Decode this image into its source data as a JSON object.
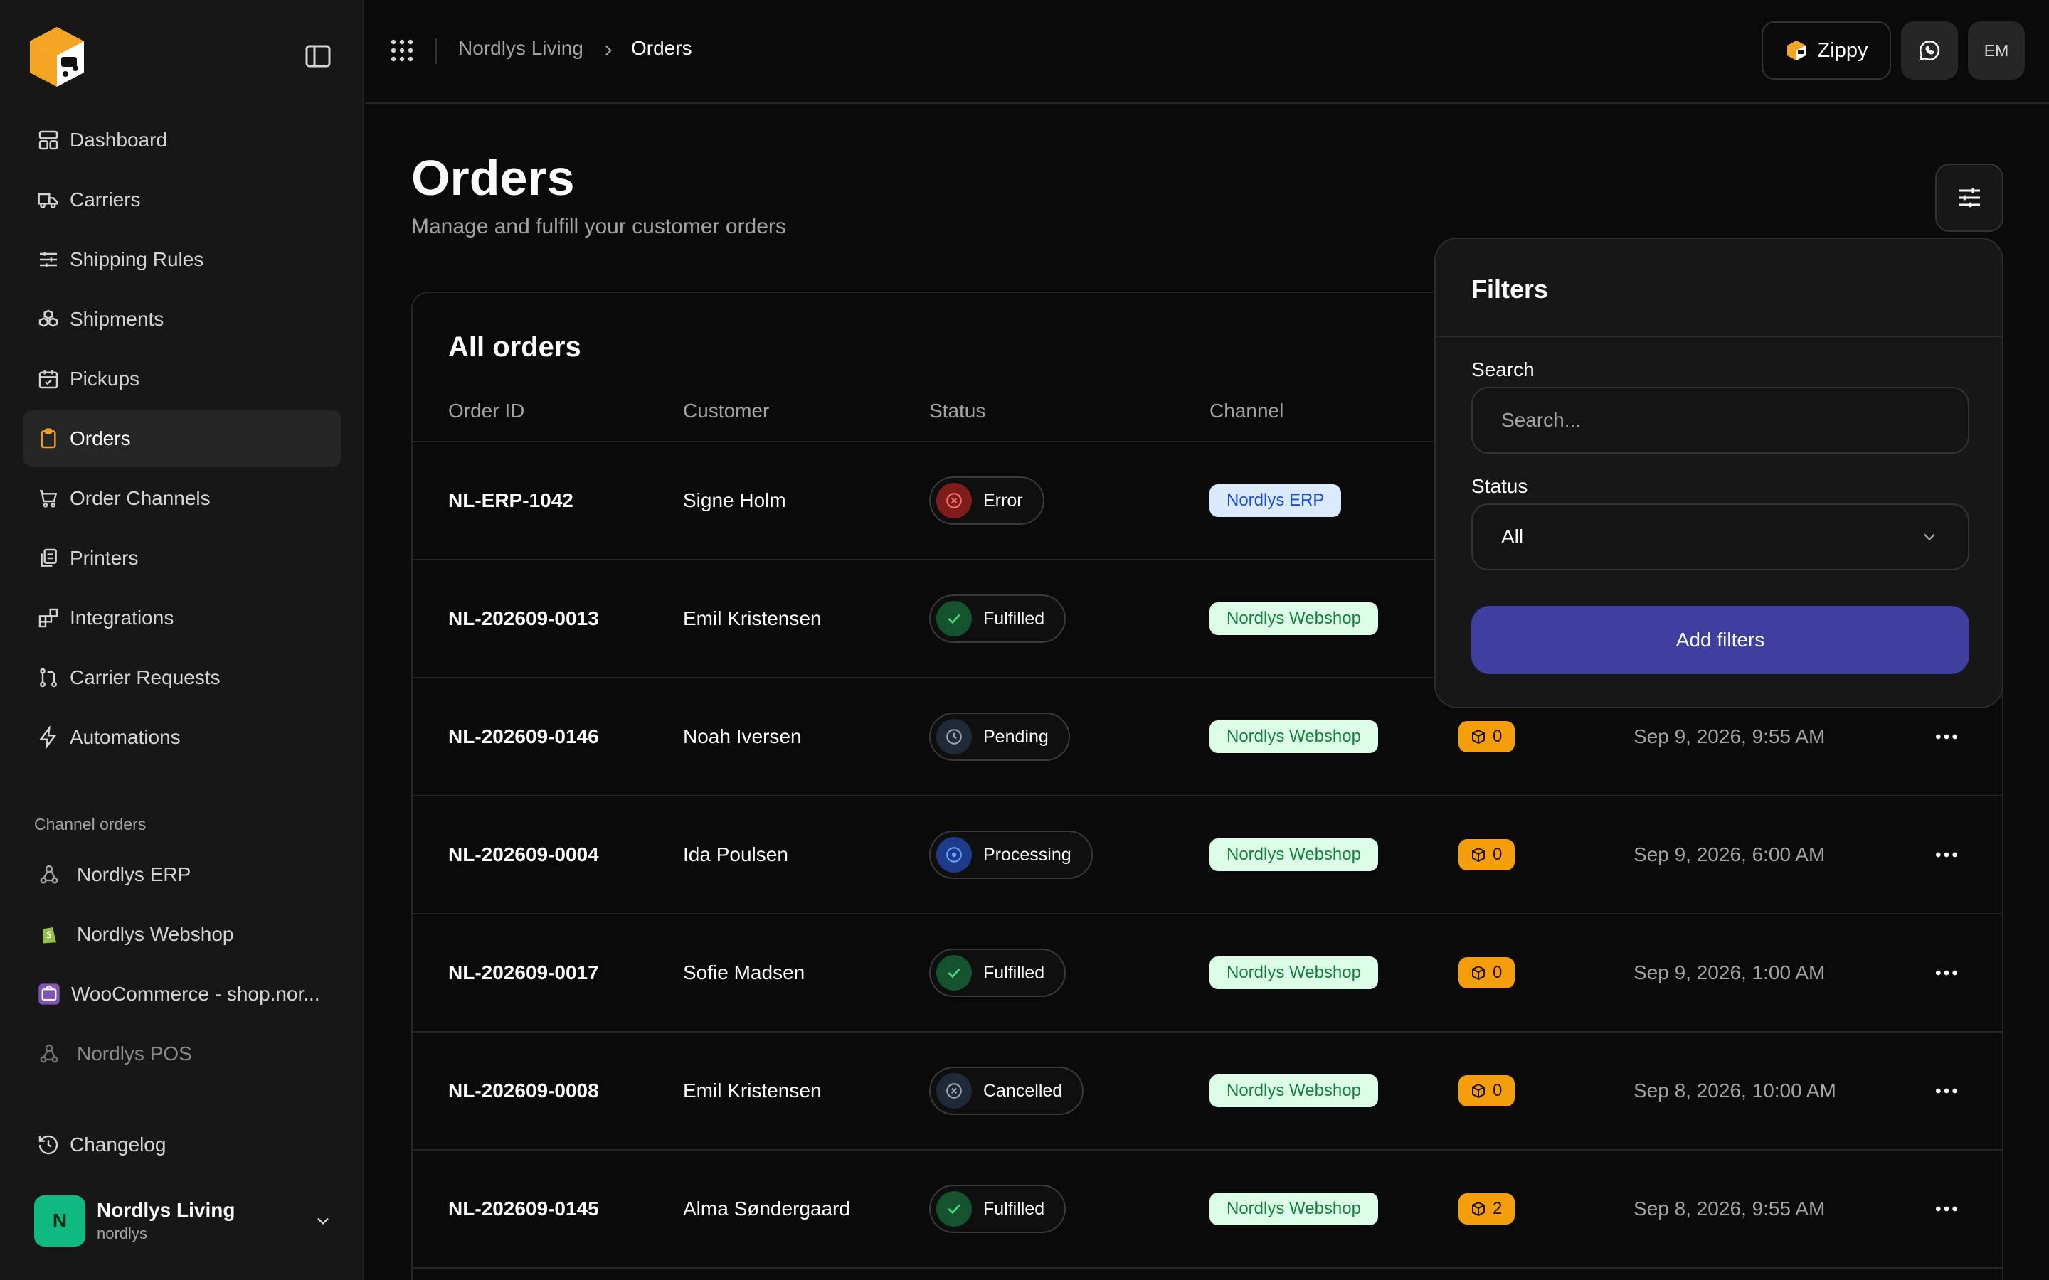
{
  "sidebar": {
    "items": [
      {
        "label": "Dashboard",
        "icon": "dashboard-icon"
      },
      {
        "label": "Carriers",
        "icon": "truck-icon"
      },
      {
        "label": "Shipping Rules",
        "icon": "sliders-icon"
      },
      {
        "label": "Shipments",
        "icon": "boxes-icon"
      },
      {
        "label": "Pickups",
        "icon": "calendar-check-icon"
      },
      {
        "label": "Orders",
        "icon": "clipboard-icon",
        "active": true
      },
      {
        "label": "Order Channels",
        "icon": "cart-icon"
      },
      {
        "label": "Printers",
        "icon": "printer-icon"
      },
      {
        "label": "Integrations",
        "icon": "blocks-icon"
      },
      {
        "label": "Carrier Requests",
        "icon": "git-pull-request-icon"
      },
      {
        "label": "Automations",
        "icon": "zap-icon"
      }
    ],
    "channel_section_label": "Channel orders",
    "channels": [
      {
        "label": "Nordlys ERP",
        "icon": "webhook-icon"
      },
      {
        "label": "Nordlys Webshop",
        "icon": "shopify-icon"
      },
      {
        "label": "WooCommerce - shop.nor...",
        "icon": "woocommerce-icon"
      },
      {
        "label": "Nordlys POS",
        "icon": "webhook-icon",
        "muted": true
      }
    ],
    "changelog": "Changelog",
    "account": {
      "initial": "N",
      "name": "Nordlys Living",
      "handle": "nordlys"
    }
  },
  "topbar": {
    "breadcrumb": [
      "Nordlys Living",
      "Orders"
    ],
    "zippy_label": "Zippy",
    "user_initials": "EM"
  },
  "page": {
    "title": "Orders",
    "subtitle": "Manage and fulfill your customer orders"
  },
  "table": {
    "title": "All orders",
    "columns": [
      "Order ID",
      "Customer",
      "Status",
      "Channel"
    ],
    "rows": [
      {
        "id": "NL-ERP-1042",
        "customer": "Signe Holm",
        "status": "Error",
        "channel": "Nordlys ERP",
        "count": "",
        "date": ""
      },
      {
        "id": "NL-202609-0013",
        "customer": "Emil Kristensen",
        "status": "Fulfilled",
        "channel": "Nordlys Webshop",
        "count": "",
        "date": ""
      },
      {
        "id": "NL-202609-0146",
        "customer": "Noah Iversen",
        "status": "Pending",
        "channel": "Nordlys Webshop",
        "count": "0",
        "date": "Sep 9, 2026, 9:55 AM"
      },
      {
        "id": "NL-202609-0004",
        "customer": "Ida Poulsen",
        "status": "Processing",
        "channel": "Nordlys Webshop",
        "count": "0",
        "date": "Sep 9, 2026, 6:00 AM"
      },
      {
        "id": "NL-202609-0017",
        "customer": "Sofie Madsen",
        "status": "Fulfilled",
        "channel": "Nordlys Webshop",
        "count": "0",
        "date": "Sep 9, 2026, 1:00 AM"
      },
      {
        "id": "NL-202609-0008",
        "customer": "Emil Kristensen",
        "status": "Cancelled",
        "channel": "Nordlys Webshop",
        "count": "0",
        "date": "Sep 8, 2026, 10:00 AM"
      },
      {
        "id": "NL-202609-0145",
        "customer": "Alma Søndergaard",
        "status": "Fulfilled",
        "channel": "Nordlys Webshop",
        "count": "2",
        "date": "Sep 8, 2026, 9:55 AM"
      }
    ]
  },
  "filters": {
    "title": "Filters",
    "search_label": "Search",
    "search_placeholder": "Search...",
    "search_value": "",
    "status_label": "Status",
    "status_value": "All",
    "submit_label": "Add filters"
  },
  "colors": {
    "accent_button": "#3f3f9f",
    "count_badge": "#f59e0b",
    "erp_badge_bg": "#dbeafe",
    "webshop_badge_bg": "#dcfce7",
    "avatar_green": "#10b981"
  }
}
